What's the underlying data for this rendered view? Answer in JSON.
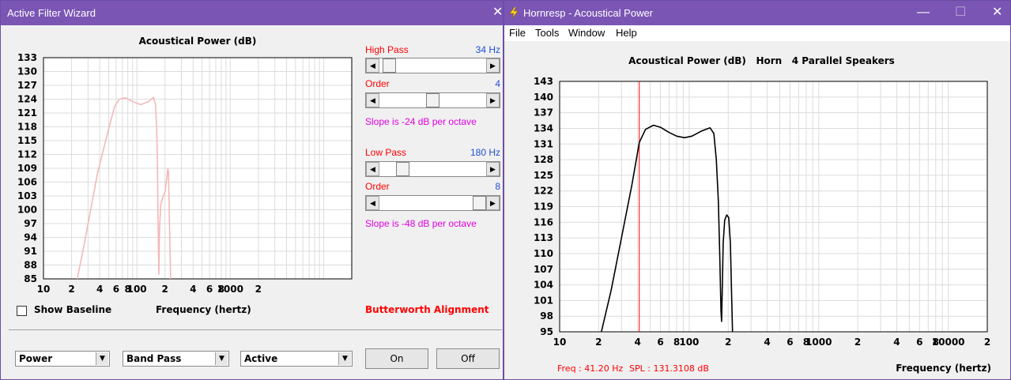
{
  "left_window": {
    "title": "Active Filter Wizard",
    "close_glyph": "✕",
    "chart_title": "Acoustical Power (dB)",
    "x_axis_label": "Frequency (hertz)",
    "show_baseline_label": "Show Baseline",
    "high_pass": {
      "label": "High Pass",
      "value": "34 Hz",
      "position": 0.03
    },
    "high_pass_order": {
      "label": "Order",
      "value": "4",
      "position": 0.5
    },
    "high_pass_slope": "Slope is -24 dB per octave",
    "low_pass": {
      "label": "Low Pass",
      "value": "180 Hz",
      "position": 0.18
    },
    "low_pass_order": {
      "label": "Order",
      "value": "8",
      "position": 1.0
    },
    "low_pass_slope": "Slope is -48 dB per octave",
    "alignment": "Butterworth Alignment",
    "combo_power": "Power",
    "combo_band": "Band Pass",
    "combo_mode": "Active",
    "on_label": "On",
    "off_label": "Off",
    "colors": {
      "curve": "#f4b8b8",
      "red": "#ff0000",
      "blue": "#1f4fd6",
      "magenta": "#e000e0"
    }
  },
  "right_window": {
    "title": "Hornresp - Acoustical Power",
    "app_icon": "lightning-bolt-icon",
    "min_glyph": "—",
    "max_glyph": "☐",
    "close_glyph": "✕",
    "menu": [
      "File",
      "Tools",
      "Window",
      "Help"
    ],
    "chart_title": "Acoustical Power (dB)   Horn   4 Parallel Speakers",
    "x_axis_label": "Frequency (hertz)",
    "freq_readout": "Freq : 41.20 Hz",
    "spl_readout": "SPL : 131.3108 dB",
    "colors": {
      "curve": "#000000",
      "cursor": "#ff0000"
    }
  },
  "chart_data": [
    {
      "type": "line",
      "title": "Acoustical Power (dB)",
      "xlabel": "Frequency (hertz)",
      "ylabel": "",
      "x_scale": "log",
      "xlim": [
        10,
        20000
      ],
      "ylim": [
        85,
        133
      ],
      "y_ticks": [
        "133",
        "130",
        "127",
        "124",
        "121",
        "118",
        "115",
        "112",
        "109",
        "106",
        "103",
        "100",
        "97",
        "94",
        "91",
        "88",
        "85"
      ],
      "y_tick_values": [
        133,
        130,
        127,
        124,
        121,
        118,
        115,
        112,
        109,
        106,
        103,
        100,
        97,
        94,
        91,
        88,
        85
      ],
      "x_ticks": [
        {
          "v": 10,
          "t": "10"
        },
        {
          "v": 20,
          "t": "2"
        },
        {
          "v": 40,
          "t": "4"
        },
        {
          "v": 60,
          "t": "6"
        },
        {
          "v": 80,
          "t": "8"
        },
        {
          "v": 100,
          "t": "100"
        },
        {
          "v": 200,
          "t": "2"
        },
        {
          "v": 400,
          "t": "4"
        },
        {
          "v": 600,
          "t": "6"
        },
        {
          "v": 800,
          "t": "8"
        },
        {
          "v": 1000,
          "t": "1000"
        },
        {
          "v": 2000,
          "t": "2"
        }
      ],
      "x": [
        23,
        27,
        32,
        38,
        45,
        52,
        58,
        65,
        75,
        90,
        110,
        135,
        150,
        158,
        163,
        166,
        168,
        170,
        172,
        175,
        180,
        190,
        200,
        210,
        215,
        218,
        222,
        226,
        230
      ],
      "y": [
        85,
        92,
        100,
        108,
        114,
        119,
        122.5,
        124,
        124.3,
        123.5,
        122.8,
        123.5,
        124.4,
        123,
        118,
        110,
        100,
        92,
        86,
        96,
        101,
        102.8,
        103.8,
        107.2,
        109,
        108.2,
        100,
        92,
        85
      ]
    },
    {
      "type": "line",
      "title": "Acoustical Power (dB)   Horn   4 Parallel Speakers",
      "xlabel": "Frequency (hertz)",
      "ylabel": "",
      "x_scale": "log",
      "xlim": [
        10,
        20000
      ],
      "ylim": [
        95,
        143
      ],
      "y_ticks": [
        "143",
        "140",
        "137",
        "134",
        "131",
        "128",
        "125",
        "122",
        "119",
        "116",
        "113",
        "110",
        "107",
        "104",
        "101",
        "98",
        "95"
      ],
      "y_tick_values": [
        143,
        140,
        137,
        134,
        131,
        128,
        125,
        122,
        119,
        116,
        113,
        110,
        107,
        104,
        101,
        98,
        95
      ],
      "x_ticks": [
        {
          "v": 10,
          "t": "10"
        },
        {
          "v": 20,
          "t": "2"
        },
        {
          "v": 40,
          "t": "4"
        },
        {
          "v": 60,
          "t": "6"
        },
        {
          "v": 80,
          "t": "8"
        },
        {
          "v": 100,
          "t": "100"
        },
        {
          "v": 200,
          "t": "2"
        },
        {
          "v": 400,
          "t": "4"
        },
        {
          "v": 600,
          "t": "6"
        },
        {
          "v": 800,
          "t": "8"
        },
        {
          "v": 1000,
          "t": "1000"
        },
        {
          "v": 2000,
          "t": "2"
        },
        {
          "v": 4000,
          "t": "4"
        },
        {
          "v": 6000,
          "t": "6"
        },
        {
          "v": 8000,
          "t": "8"
        },
        {
          "v": 10000,
          "t": "10000"
        },
        {
          "v": 20000,
          "t": "2"
        }
      ],
      "cursor_x": 41.2,
      "x": [
        21,
        25,
        30,
        36,
        41.2,
        46,
        53,
        60,
        70,
        80,
        92,
        105,
        125,
        145,
        155,
        162,
        168,
        172,
        176,
        178,
        180,
        183,
        188,
        195,
        202,
        208,
        212,
        216
      ],
      "y": [
        95,
        103,
        113,
        123,
        131.3,
        133.8,
        134.6,
        134.2,
        133.2,
        132.5,
        132.2,
        132.5,
        133.5,
        134.1,
        133,
        128,
        120,
        110,
        99,
        97,
        103,
        112,
        116.4,
        117.4,
        116.9,
        112,
        103,
        95
      ]
    }
  ]
}
